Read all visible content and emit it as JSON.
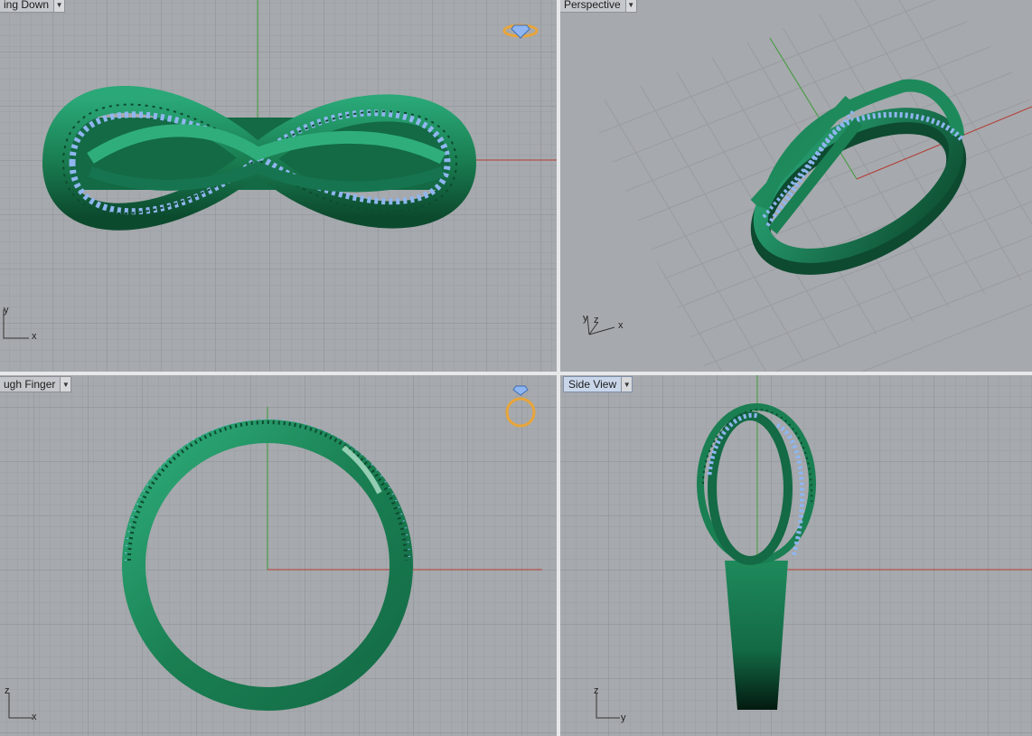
{
  "viewports": {
    "top_left": {
      "title": "ing Down",
      "axis": {
        "vertical": "y",
        "horizontal": "x"
      }
    },
    "top_right": {
      "title": "Perspective",
      "axis": {
        "vertical": "y",
        "depth": "z",
        "horizontal": "x"
      }
    },
    "bottom_left": {
      "title": "ugh Finger",
      "axis": {
        "vertical": "z",
        "horizontal": "x"
      }
    },
    "bottom_right": {
      "title": "Side View",
      "axis": {
        "vertical": "z",
        "horizontal": "y"
      }
    }
  },
  "colors": {
    "background": "#a6a9ad",
    "grid_minor": "#9a9da1",
    "grid_major": "#8b8e92",
    "axis_x": "#b43a32",
    "axis_y": "#3f9c3a",
    "ring_green": "#1f8a5c",
    "ring_dark": "#0d4a30",
    "stone_blue": "#8fb6f0",
    "gizmo_gold": "#e8a53a",
    "active_title": "#c9d6ea",
    "divider": "#e6e8ea"
  },
  "icons": {
    "ring_gizmo_top": "ring-top-view-icon",
    "ring_gizmo_side": "ring-front-view-icon",
    "dropdown": "chevron-down-icon"
  }
}
